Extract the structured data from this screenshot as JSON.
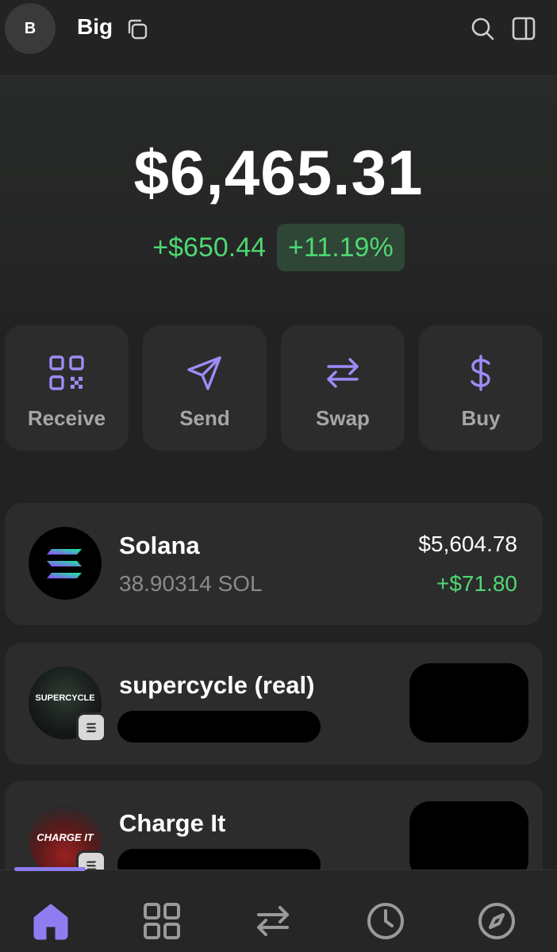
{
  "header": {
    "avatar_letter": "B",
    "account_name": "Big",
    "icons": [
      "copy-icon",
      "search-icon",
      "sidebar-panel-icon"
    ]
  },
  "balance": {
    "total": "$6,465.31",
    "change_amount": "+$650.44",
    "change_percent": "+11.19%"
  },
  "actions": [
    {
      "label": "Receive",
      "icon": "qr-code-icon"
    },
    {
      "label": "Send",
      "icon": "send-icon"
    },
    {
      "label": "Swap",
      "icon": "swap-icon"
    },
    {
      "label": "Buy",
      "icon": "dollar-icon"
    }
  ],
  "tokens": [
    {
      "name": "Solana",
      "amount": "38.90314 SOL",
      "value": "$5,604.78",
      "change": "+$71.80",
      "icon": "solana-logo-icon"
    },
    {
      "name": "supercycle (real)",
      "logo_text": "SUPERCYCLE",
      "icon": "solana-chain-badge-icon"
    },
    {
      "name": "Charge It",
      "logo_text": "CHARGE IT",
      "icon": "solana-chain-badge-icon"
    }
  ],
  "bottom_nav": {
    "items": [
      "home-icon",
      "grid-icon",
      "swap-icon",
      "history-clock-icon",
      "explore-compass-icon"
    ],
    "active": "home-icon"
  },
  "colors": {
    "accent": "#8e7df0",
    "positive": "#4fd773",
    "background": "#222222",
    "card": "#2c2c2c"
  }
}
